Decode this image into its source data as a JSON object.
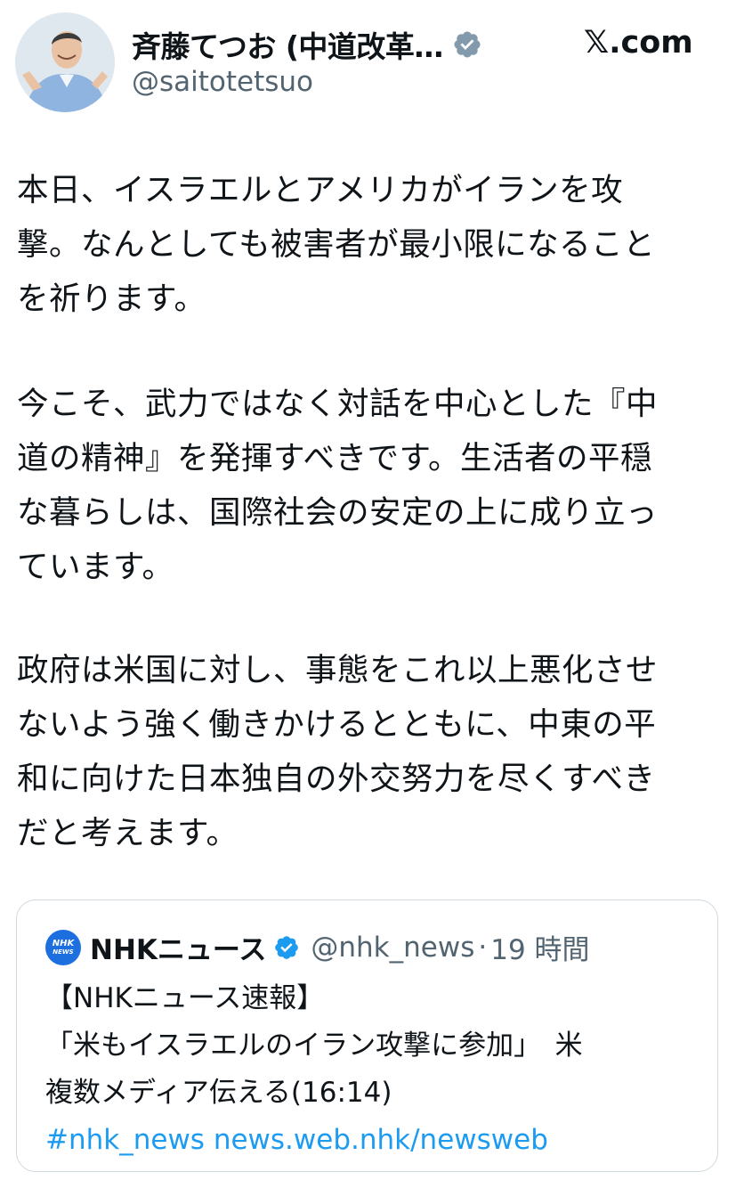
{
  "author": {
    "name": "斉藤てつお (中道改革…",
    "handle": "@saitotetsuo"
  },
  "site": "𝕏.com",
  "paragraphs": [
    [
      "本日、イスラエルとアメリカがイランを攻",
      "撃。なんとしても被害者が最小限になること",
      "を祈ります。"
    ],
    [
      "今こそ、武力ではなく対話を中心とした『中",
      "道の精神』を発揮すべきです。生活者の平穏",
      "な暮らしは、国際社会の安定の上に成り立っ",
      "ています。"
    ],
    [
      "政府は米国に対し、事態をこれ以上悪化させ",
      "ないよう強く働きかけるとともに、中東の平",
      "和に向けた日本独自の外交努力を尽くすべき",
      "だと考えます。"
    ]
  ],
  "quote": {
    "logo_text": "NHK",
    "logo_subtext": "NEWS",
    "name": "NHKニュース",
    "handle": "@nhk_news",
    "separator": "·",
    "time": "19 時間",
    "lines": [
      "【NHKニュース速報】",
      "「米もイスラエルのイラン攻撃に参加」　米",
      "複数メディア伝える(16:14)"
    ],
    "hashtag": "#nhk_news",
    "link": "news.web.nhk/newsweb"
  },
  "colors": {
    "verified": "#829aab",
    "link": "#1d9bf0",
    "nhk_logo": "#1d6fe0"
  }
}
